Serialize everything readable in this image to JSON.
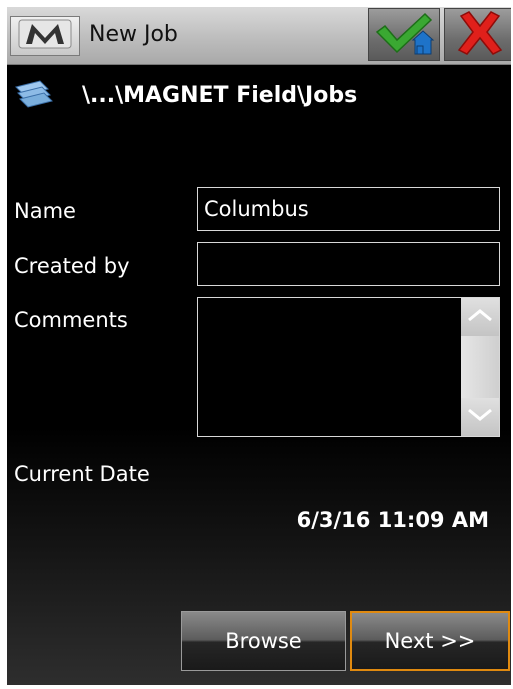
{
  "titlebar": {
    "title": "New Job",
    "menu_icon": "m-logo-icon",
    "ok_icon": "check-home-icon",
    "cancel_icon": "red-x-icon",
    "colors": {
      "check": "#3aa832",
      "cancel": "#e0201b"
    }
  },
  "path": {
    "text": "\\...\\MAGNET Field\\Jobs",
    "icon": "folder-stack-icon"
  },
  "form": {
    "name_label": "Name",
    "name_value": "Columbus",
    "created_by_label": "Created by",
    "created_by_value": "",
    "comments_label": "Comments",
    "comments_value": "",
    "current_date_label": "Current Date",
    "current_date_value": "6/3/16 11:09 AM"
  },
  "buttons": {
    "browse": "Browse",
    "next": "Next >>"
  },
  "colors": {
    "accent_border": "#e08a10"
  }
}
